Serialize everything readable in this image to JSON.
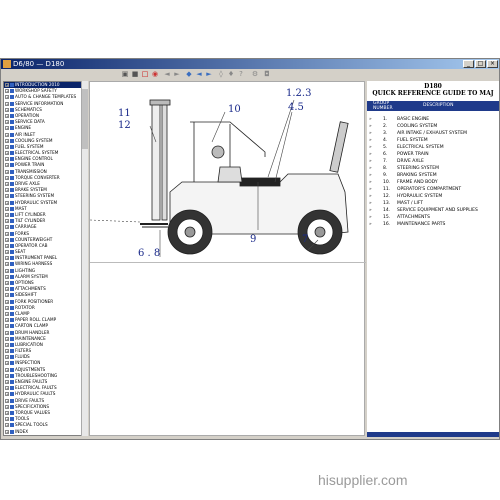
{
  "window": {
    "title": "D6/80 — D180"
  },
  "menu": [
    "File",
    "Edit",
    "View",
    "Help"
  ],
  "toolbar_icons": [
    "open-icon",
    "print-icon",
    "copy-icon",
    "zoom-icon",
    "back-icon",
    "forward-icon",
    "home-icon",
    "prev-icon",
    "next-icon",
    "find-icon",
    "bookmark-icon",
    "help-icon"
  ],
  "tree": {
    "items": [
      "INTRODUCTION 2010",
      "WORKSHOP SAFETY",
      "AUTO & CHANGE TEMPLATES",
      "SERVICE INFORMATION",
      "SCHEMATICS",
      "OPERATION",
      "SERVICE DATA",
      "ENGINE",
      "AIR INLET",
      "COOLING SYSTEM",
      "FUEL SYSTEM",
      "ELECTRICAL SYSTEM",
      "ENGINE CONTROL",
      "POWER TRAIN",
      "TRANSMISSION",
      "TORQUE CONVERTER",
      "DRIVE AXLE",
      "BRAKE SYSTEM",
      "STEERING SYSTEM",
      "HYDRAULIC SYSTEM",
      "MAST",
      "LIFT CYLINDER",
      "TILT CYLINDER",
      "CARRIAGE",
      "FORKS",
      "COUNTERWEIGHT",
      "OPERATOR CAB",
      "SEAT",
      "INSTRUMENT PANEL",
      "WIRING HARNESS",
      "LIGHTING",
      "ALARM SYSTEM",
      "OPTIONS",
      "ATTACHMENTS",
      "SIDESHIFT",
      "FORK POSITIONER",
      "ROTATOR",
      "CLAMP",
      "PAPER ROLL CLAMP",
      "CARTON CLAMP",
      "DRUM HANDLER",
      "MAINTENANCE",
      "LUBRICATION",
      "FILTERS",
      "FLUIDS",
      "INSPECTION",
      "ADJUSTMENTS",
      "TROUBLESHOOTING",
      "ENGINE FAULTS",
      "ELECTRICAL FAULTS",
      "HYDRAULIC FAULTS",
      "DRIVE FAULTS",
      "SPECIFICATIONS",
      "TORQUE VALUES",
      "TOOLS",
      "SPECIAL TOOLS",
      "INDEX"
    ]
  },
  "diagram": {
    "callouts": [
      "1.2.3",
      "4.5",
      "10",
      "11",
      "12",
      "6 . 8",
      "9",
      "7"
    ]
  },
  "quickref": {
    "model": "D180",
    "title": "QUICK REFERENCE GUIDE TO MAJ",
    "col_group": "GROUP",
    "col_group_sub": "NUMBER",
    "col_desc": "DESCRIPTION",
    "items": [
      "BASIC ENGINE",
      "COOLING SYSTEM",
      "AIR INTAKE / EXHAUST SYSTEM",
      "FUEL SYSTEM",
      "ELECTRICAL SYSTEM",
      "POWER TRAIN",
      "DRIVE AXLE",
      "STEERING SYSTEM",
      "BRAKING SYSTEM",
      "FRAME AND BODY",
      "OPERATOR'S COMPARTMENT",
      "HYDRAULIC SYSTEM",
      "MAST / LIFT",
      "SERVICE EQUIPMENT AND SUPPLIES",
      "ATTACHMENTS",
      "MAINTENANCE PARTS"
    ]
  },
  "watermark": "hisupplier.com",
  "colors": {
    "accent": "#1f3a8a",
    "titlebar": "#0a246a",
    "callout": "#1a2a8a"
  }
}
